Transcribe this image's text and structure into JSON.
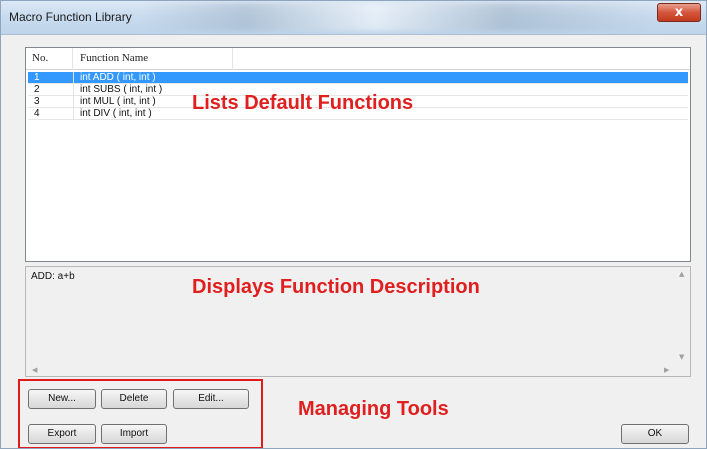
{
  "window": {
    "title": "Macro Function Library",
    "close_glyph": "x"
  },
  "list": {
    "columns": [
      "No.",
      "Function Name"
    ],
    "rows": [
      {
        "no": "1",
        "name": "int ADD ( int, int )",
        "selected": true
      },
      {
        "no": "2",
        "name": "int SUBS ( int, int )",
        "selected": false
      },
      {
        "no": "3",
        "name": "int MUL ( int, int )",
        "selected": false
      },
      {
        "no": "4",
        "name": "int DIV ( int, int )",
        "selected": false
      }
    ]
  },
  "description": {
    "text": "ADD: a+b"
  },
  "buttons": {
    "new": "New...",
    "delete": "Delete",
    "edit": "Edit...",
    "export": "Export",
    "import": "Import",
    "ok": "OK"
  },
  "annotations": {
    "list": "Lists Default Functions",
    "description": "Displays Function Description",
    "tools": "Managing Tools"
  },
  "colors": {
    "annotation": "#e01f1f",
    "selection": "#3399ff"
  }
}
